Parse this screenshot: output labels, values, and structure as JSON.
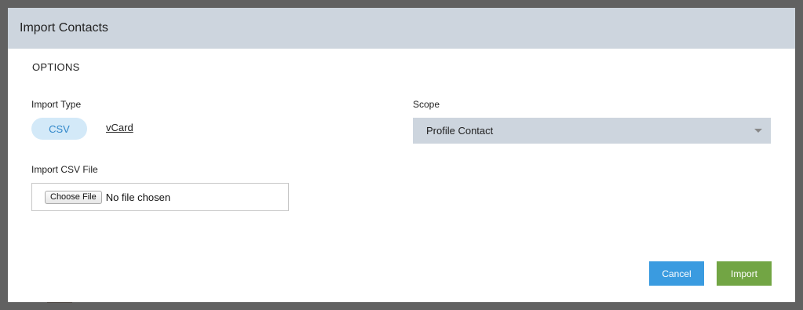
{
  "modal": {
    "title": "Import Contacts",
    "section_title": "OPTIONS"
  },
  "import_type": {
    "label": "Import Type",
    "options": [
      "CSV",
      "vCard"
    ],
    "selected": "CSV"
  },
  "scope": {
    "label": "Scope",
    "selected": "Profile Contact"
  },
  "file": {
    "label": "Import CSV File",
    "choose_label": "Choose File",
    "status": "No file chosen"
  },
  "footer": {
    "cancel_label": "Cancel",
    "import_label": "Import"
  },
  "colors": {
    "header_bg": "#cdd5de",
    "cancel_bg": "#3a9be0",
    "import_bg": "#72a544",
    "selected_toggle_bg": "#d3e9f8",
    "selected_toggle_text": "#2f86c9"
  }
}
